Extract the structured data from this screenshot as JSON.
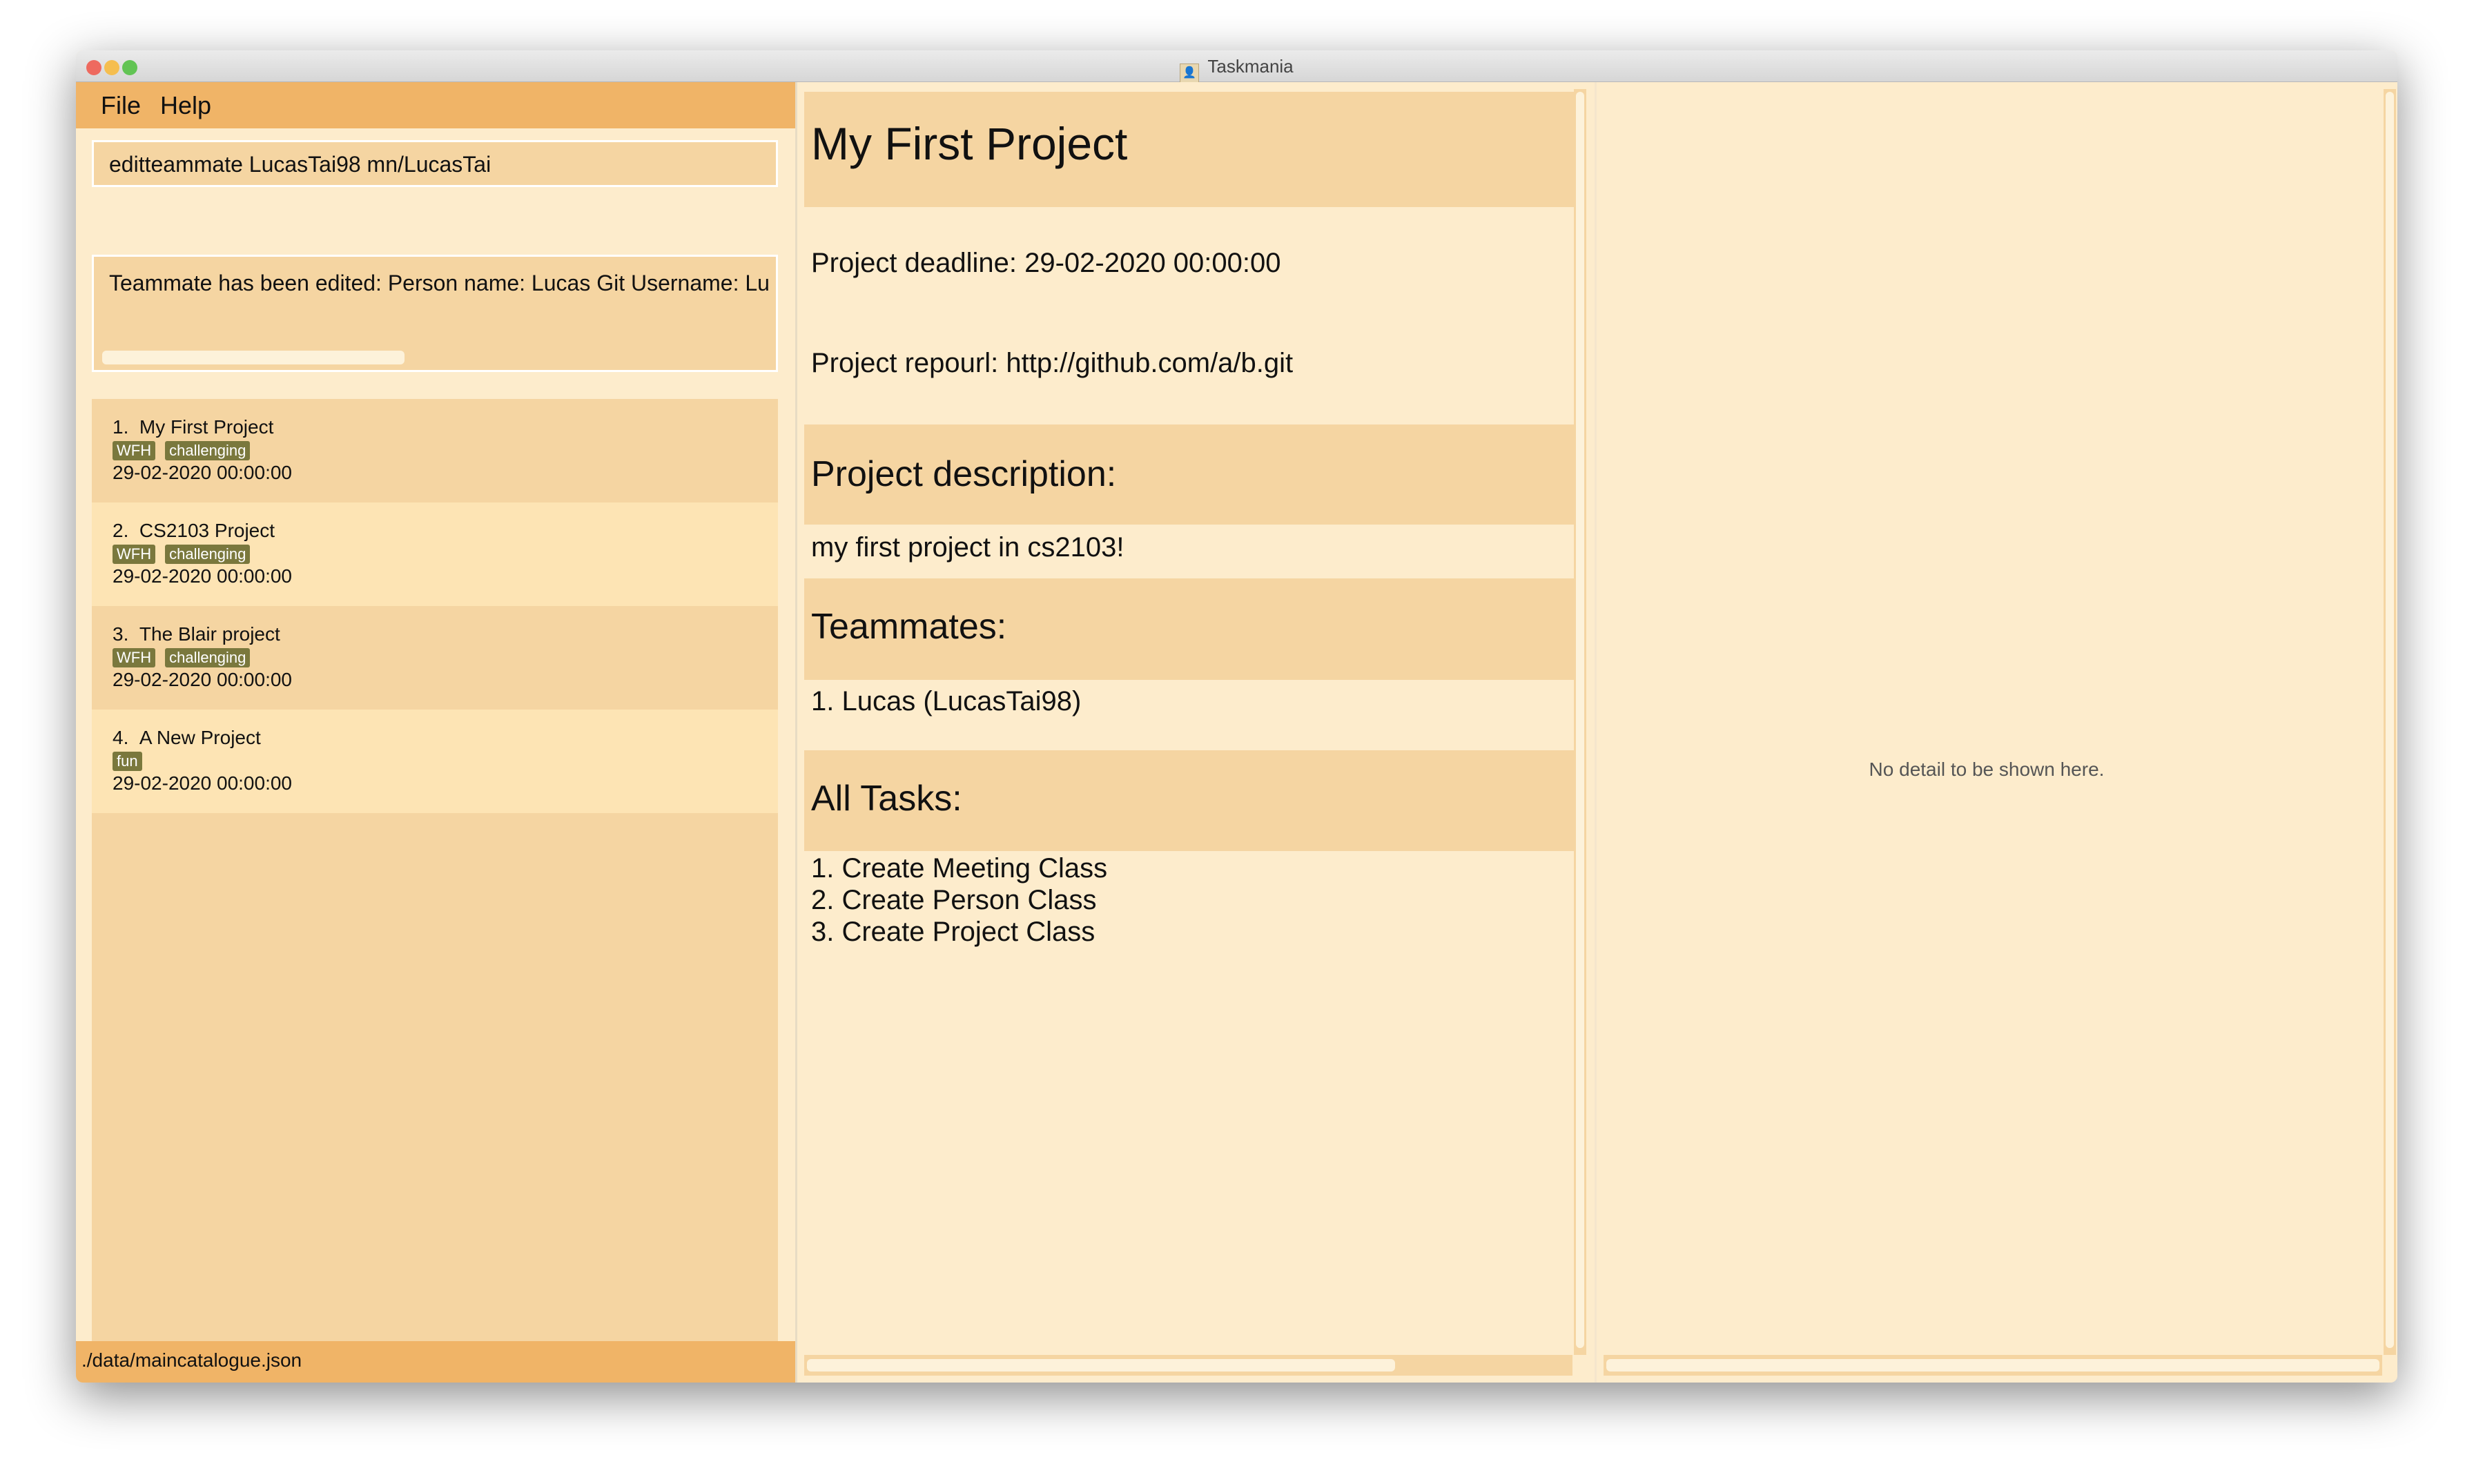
{
  "window": {
    "title": "Taskmania",
    "controls": {
      "close": "#ee6a5f",
      "minimize": "#f5be4f",
      "zoom": "#62c454"
    }
  },
  "menu": {
    "file": "File",
    "help": "Help"
  },
  "command_box": {
    "value": "editteammate LucasTai98 mn/LucasTai"
  },
  "result_box": {
    "text": "Teammate has been edited:  Person name: Lucas Git Username: Lu"
  },
  "projects": [
    {
      "index": "1.",
      "name": "My First Project",
      "tags": [
        "WFH",
        "challenging"
      ],
      "deadline": "29-02-2020 00:00:00"
    },
    {
      "index": "2.",
      "name": "CS2103 Project",
      "tags": [
        "WFH",
        "challenging"
      ],
      "deadline": "29-02-2020 00:00:00"
    },
    {
      "index": "3.",
      "name": "The Blair project",
      "tags": [
        "WFH",
        "challenging"
      ],
      "deadline": "29-02-2020 00:00:00"
    },
    {
      "index": "4.",
      "name": "A New Project",
      "tags": [
        "fun"
      ],
      "deadline": "29-02-2020 00:00:00"
    }
  ],
  "status_bar": {
    "path": "./data/maincatalogue.json"
  },
  "detail": {
    "title": "My First Project",
    "deadline": "Project deadline: 29-02-2020 00:00:00",
    "repourl": "Project repourl: http://github.com/a/b.git",
    "description_header": "Project description:",
    "description": "my first project in cs2103!",
    "teammates_header": "Teammates:",
    "teammates": [
      "1. Lucas (LucasTai98)"
    ],
    "tasks_header": "All Tasks:",
    "tasks": [
      "1. Create Meeting Class",
      "2. Create Person Class",
      "3. Create Project Class"
    ]
  },
  "right_panel": {
    "empty_text": "No detail to be shown here."
  },
  "colors": {
    "accent": "#f0b467",
    "panel": "#fdeccc",
    "band": "#f5d5a2",
    "tag": "#7a783d"
  }
}
